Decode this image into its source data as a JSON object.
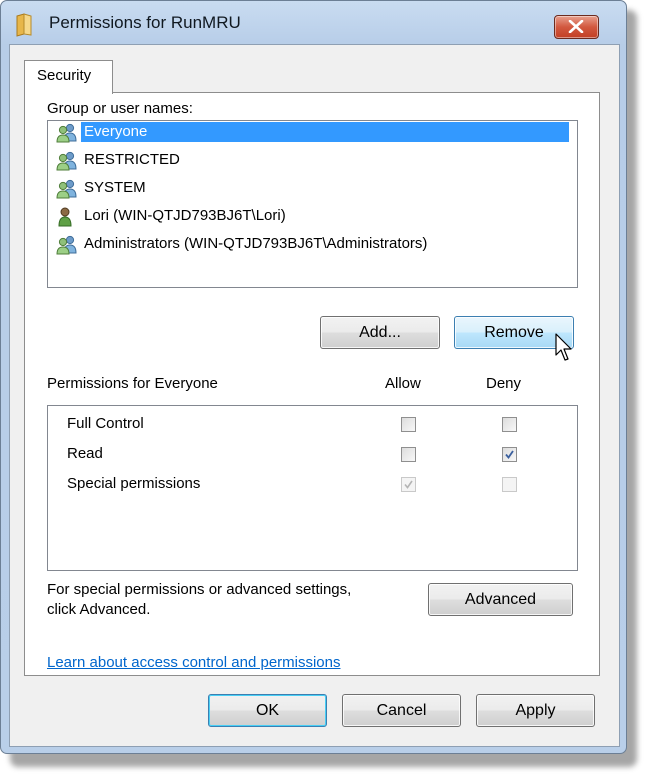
{
  "window": {
    "title": "Permissions for RunMRU"
  },
  "tabs": [
    {
      "label": "Security"
    }
  ],
  "groups_label": "Group or user names:",
  "users": [
    {
      "name": "Everyone",
      "icon": "group-icon",
      "selected": true
    },
    {
      "name": "RESTRICTED",
      "icon": "group-icon",
      "selected": false
    },
    {
      "name": "SYSTEM",
      "icon": "group-icon",
      "selected": false
    },
    {
      "name": "Lori (WIN-QTJD793BJ6T\\Lori)",
      "icon": "user-icon",
      "selected": false
    },
    {
      "name": "Administrators (WIN-QTJD793BJ6T\\Administrators)",
      "icon": "group-icon",
      "selected": false
    }
  ],
  "buttons": {
    "add": "Add...",
    "remove": "Remove",
    "advanced": "Advanced",
    "ok": "OK",
    "cancel": "Cancel",
    "apply": "Apply"
  },
  "permissions": {
    "header": "Permissions for Everyone",
    "allow_label": "Allow",
    "deny_label": "Deny",
    "rows": [
      {
        "name": "Full Control",
        "allow": false,
        "allow_disabled": false,
        "deny": false,
        "deny_disabled": false
      },
      {
        "name": "Read",
        "allow": false,
        "allow_disabled": false,
        "deny": true,
        "deny_disabled": false
      },
      {
        "name": "Special permissions",
        "allow": true,
        "allow_disabled": true,
        "deny": false,
        "deny_disabled": true
      }
    ]
  },
  "advanced_text_line1": "For special permissions or advanced settings,",
  "advanced_text_line2": "click Advanced.",
  "learn_link": "Learn about access control and permissions",
  "colors": {
    "selection": "#3399ff",
    "link": "#0066cc",
    "close_button": "#c94a30"
  }
}
